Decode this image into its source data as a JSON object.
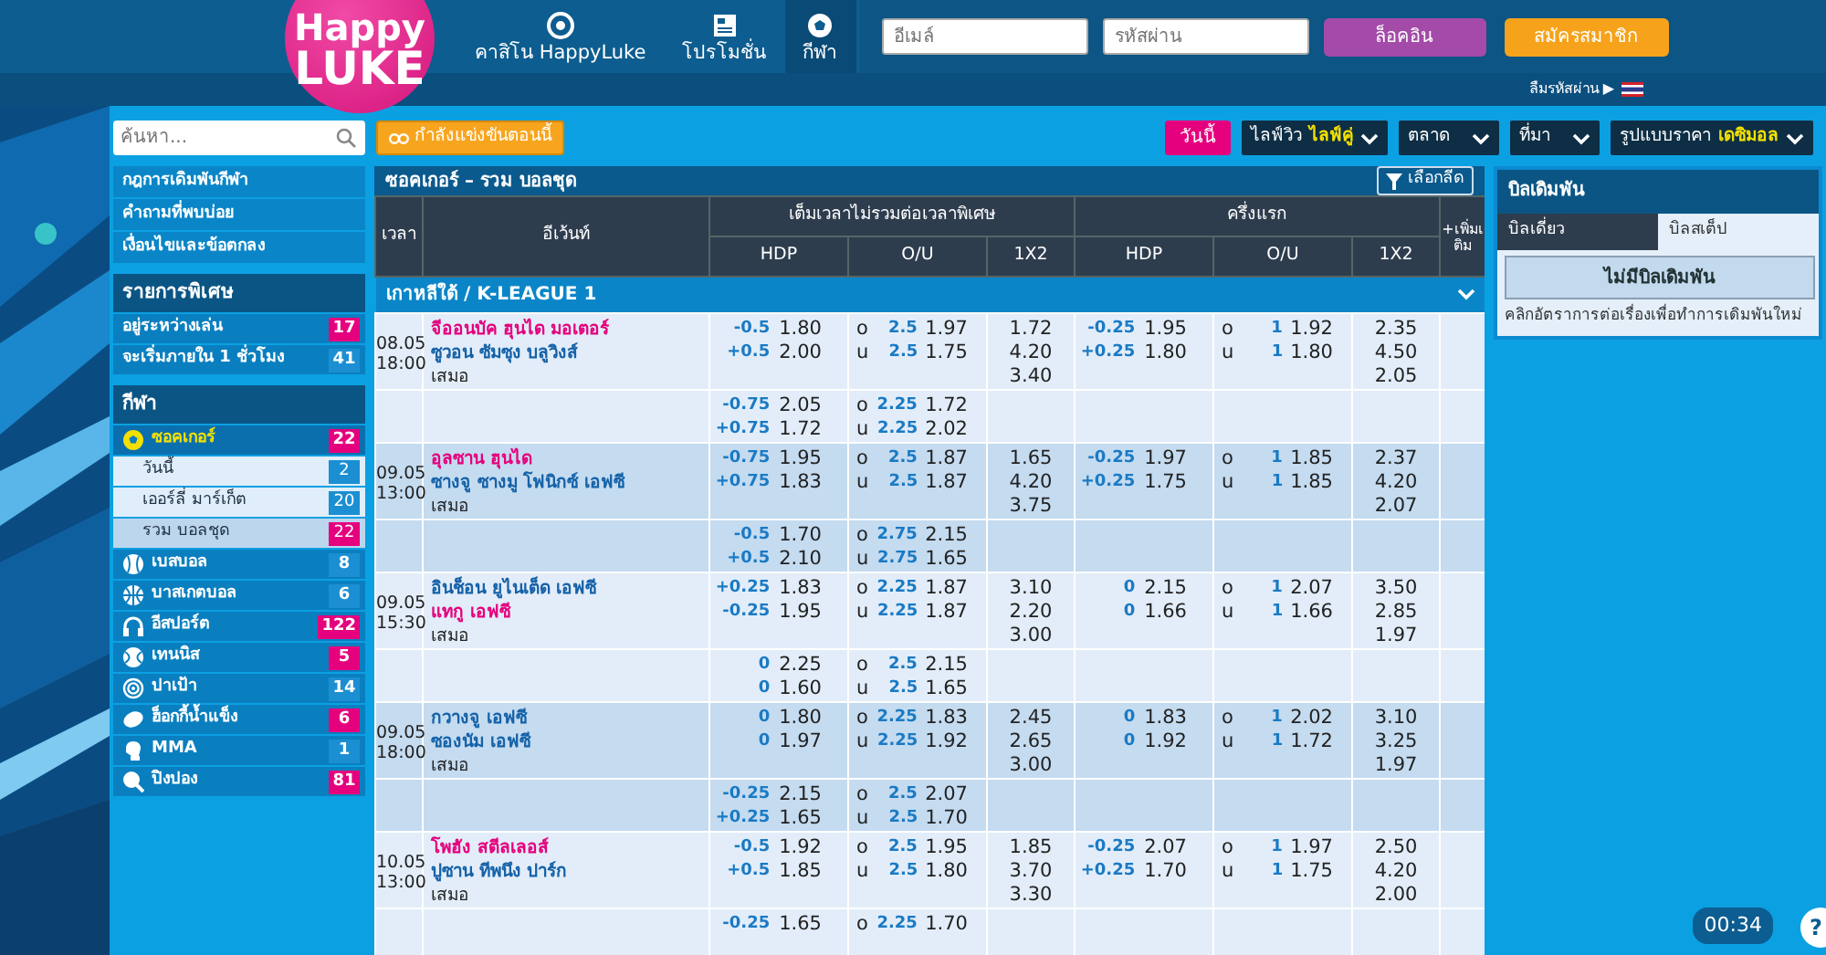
{
  "logo": {
    "line1": "Happy",
    "line2": "LUKE"
  },
  "nav": [
    {
      "label": "คาสิโน HappyLuke",
      "selected": false
    },
    {
      "label": "โปรโมชั่น",
      "selected": false
    },
    {
      "label": "กีฬา",
      "selected": true
    }
  ],
  "login": {
    "email_placeholder": "อีเมล์",
    "password_placeholder": "รหัสผ่าน",
    "login_button": "ล็อคอิน",
    "register_button": "สมัครสมาชิก",
    "forgot_link": "ลืมรหัสผ่าน ▶"
  },
  "toolbar": {
    "search_placeholder": "ค้นหา...",
    "live_button": "กำลังแข่งขันตอนนี้",
    "today_button": "วันนี้",
    "dropdowns": [
      {
        "label": "ไลฟ์วิว",
        "value": "ไลฟ์คู่"
      },
      {
        "label": "ตลาด"
      },
      {
        "label": "ที่มา"
      },
      {
        "label": "รูปแบบราคา",
        "value": "เดซิมอล"
      }
    ]
  },
  "sidebar": {
    "links": [
      "กฎการเดิมพันกีฬา",
      "คำถามที่พบบ่อย",
      "เงื่อนไขและข้อตกลง"
    ],
    "special_title": "รายการพิเศษ",
    "special": [
      {
        "name": "อยู่ระหว่างเล่น",
        "count": "17",
        "color": "#e5007d"
      },
      {
        "name": "จะเริ่มภายใน 1 ชั่วโมง",
        "count": "41",
        "color": "#1b8fd2"
      }
    ],
    "sports_title": "กีฬา",
    "sports": [
      {
        "name": "ซอคเกอร์",
        "count": "22",
        "color": "#e5007d",
        "selected": true,
        "expanded": true,
        "children": [
          {
            "name": "วันนี้",
            "count": "2",
            "color": "#1b8fd2",
            "selected": false
          },
          {
            "name": "เออร์ลี่ มาร์เก็ต",
            "count": "20",
            "color": "#1b8fd2",
            "selected": false
          },
          {
            "name": "รวม บอลชุด",
            "count": "22",
            "color": "#e5007d",
            "selected": true
          }
        ]
      },
      {
        "name": "เบสบอล",
        "count": "8",
        "color": "#1b8fd2",
        "selected": false
      },
      {
        "name": "บาสเกตบอล",
        "count": "6",
        "color": "#1b8fd2",
        "selected": false
      },
      {
        "name": "อีสปอร์ต",
        "count": "122",
        "color": "#e5007d",
        "selected": false
      },
      {
        "name": "เทนนิส",
        "count": "5",
        "color": "#e5007d",
        "selected": false
      },
      {
        "name": "ปาเป้า",
        "count": "14",
        "color": "#1b8fd2",
        "selected": false
      },
      {
        "name": "ฮ็อกกี้น้ำแข็ง",
        "count": "6",
        "color": "#e5007d",
        "selected": false
      },
      {
        "name": "MMA",
        "count": "1",
        "color": "#1b8fd2",
        "selected": false
      },
      {
        "name": "ปิงปอง",
        "count": "81",
        "color": "#e5007d",
        "selected": false
      }
    ]
  },
  "table": {
    "title": "ซอคเกอร์ – รวม บอลชุด",
    "filter_button": "เลือกลีด",
    "col_time": "เวลา",
    "col_event": "อีเว้นท์",
    "group_ft": "เต็มเวลาไม่รวมต่อเวลาพิเศษ",
    "group_fh": "ครึ่งแรก",
    "ft_cols": [
      "HDP",
      "O/U",
      "1X2"
    ],
    "fh_cols": [
      "HDP",
      "O/U",
      "1X2"
    ],
    "col_more": "+เพิ่มเติม",
    "league": {
      "name": "เกาหลีใต้ / K-LEAGUE 1",
      "expanded": true
    },
    "matches": [
      {
        "date": "08.05",
        "time": "18:00",
        "home": {
          "name": "จีออนบัค ฮุนได มอเตอร์",
          "favorite": true
        },
        "away": {
          "name": "ซูวอน ซัมซุง บลูวิงส์",
          "favorite": false
        },
        "draw": "เสมอ",
        "ft": {
          "hdp": [
            {
              "line": "-0.5",
              "odds": "1.80"
            },
            {
              "line": "+0.5",
              "odds": "2.00"
            }
          ],
          "ou": [
            {
              "side": "o",
              "line": "2.5",
              "odds": "1.97"
            },
            {
              "side": "u",
              "line": "2.5",
              "odds": "1.75"
            }
          ],
          "x12": [
            "1.72",
            "4.20",
            "3.40"
          ]
        },
        "fh": {
          "hdp": [
            {
              "line": "-0.25",
              "odds": "1.95"
            },
            {
              "line": "+0.25",
              "odds": "1.80"
            }
          ],
          "ou": [
            {
              "side": "o",
              "line": "1",
              "odds": "1.92"
            },
            {
              "side": "u",
              "line": "1",
              "odds": "1.80"
            }
          ],
          "x12": [
            "2.35",
            "4.50",
            "2.05"
          ]
        },
        "alt": {
          "hdp": [
            {
              "line": "-0.75",
              "odds": "2.05"
            },
            {
              "line": "+0.75",
              "odds": "1.72"
            }
          ],
          "ou": [
            {
              "side": "o",
              "line": "2.25",
              "odds": "1.72"
            },
            {
              "side": "u",
              "line": "2.25",
              "odds": "2.02"
            }
          ]
        }
      },
      {
        "date": "09.05",
        "time": "13:00",
        "home": {
          "name": "อุลซาน ฮุนได",
          "favorite": true
        },
        "away": {
          "name": "ซางจู ซางมู โฟนิกซ์ เอฟซี",
          "favorite": false
        },
        "draw": "เสมอ",
        "ft": {
          "hdp": [
            {
              "line": "-0.75",
              "odds": "1.95"
            },
            {
              "line": "+0.75",
              "odds": "1.83"
            }
          ],
          "ou": [
            {
              "side": "o",
              "line": "2.5",
              "odds": "1.87"
            },
            {
              "side": "u",
              "line": "2.5",
              "odds": "1.87"
            }
          ],
          "x12": [
            "1.65",
            "4.20",
            "3.75"
          ]
        },
        "fh": {
          "hdp": [
            {
              "line": "-0.25",
              "odds": "1.97"
            },
            {
              "line": "+0.25",
              "odds": "1.75"
            }
          ],
          "ou": [
            {
              "side": "o",
              "line": "1",
              "odds": "1.85"
            },
            {
              "side": "u",
              "line": "1",
              "odds": "1.85"
            }
          ],
          "x12": [
            "2.37",
            "4.20",
            "2.07"
          ]
        },
        "alt": {
          "hdp": [
            {
              "line": "-0.5",
              "odds": "1.70"
            },
            {
              "line": "+0.5",
              "odds": "2.10"
            }
          ],
          "ou": [
            {
              "side": "o",
              "line": "2.75",
              "odds": "2.15"
            },
            {
              "side": "u",
              "line": "2.75",
              "odds": "1.65"
            }
          ]
        }
      },
      {
        "date": "09.05",
        "time": "15:30",
        "home": {
          "name": "อินช็อน ยูไนเต็ด เอฟซี",
          "favorite": false
        },
        "away": {
          "name": "แทกู เอฟซี",
          "favorite": true
        },
        "draw": "เสมอ",
        "ft": {
          "hdp": [
            {
              "line": "+0.25",
              "odds": "1.83"
            },
            {
              "line": "-0.25",
              "odds": "1.95"
            }
          ],
          "ou": [
            {
              "side": "o",
              "line": "2.25",
              "odds": "1.87"
            },
            {
              "side": "u",
              "line": "2.25",
              "odds": "1.87"
            }
          ],
          "x12": [
            "3.10",
            "2.20",
            "3.00"
          ]
        },
        "fh": {
          "hdp": [
            {
              "line": "0",
              "odds": "2.15"
            },
            {
              "line": "0",
              "odds": "1.66"
            }
          ],
          "ou": [
            {
              "side": "o",
              "line": "1",
              "odds": "2.07"
            },
            {
              "side": "u",
              "line": "1",
              "odds": "1.66"
            }
          ],
          "x12": [
            "3.50",
            "2.85",
            "1.97"
          ]
        },
        "alt": {
          "hdp": [
            {
              "line": "0",
              "odds": "2.25"
            },
            {
              "line": "0",
              "odds": "1.60"
            }
          ],
          "ou": [
            {
              "side": "o",
              "line": "2.5",
              "odds": "2.15"
            },
            {
              "side": "u",
              "line": "2.5",
              "odds": "1.65"
            }
          ]
        }
      },
      {
        "date": "09.05",
        "time": "18:00",
        "home": {
          "name": "กวางจู เอฟซี",
          "favorite": false
        },
        "away": {
          "name": "ซองนัม เอฟซี",
          "favorite": false
        },
        "draw": "เสมอ",
        "ft": {
          "hdp": [
            {
              "line": "0",
              "odds": "1.80"
            },
            {
              "line": "0",
              "odds": "1.97"
            }
          ],
          "ou": [
            {
              "side": "o",
              "line": "2.25",
              "odds": "1.83"
            },
            {
              "side": "u",
              "line": "2.25",
              "odds": "1.92"
            }
          ],
          "x12": [
            "2.45",
            "2.65",
            "3.00"
          ]
        },
        "fh": {
          "hdp": [
            {
              "line": "0",
              "odds": "1.83"
            },
            {
              "line": "0",
              "odds": "1.92"
            }
          ],
          "ou": [
            {
              "side": "o",
              "line": "1",
              "odds": "2.02"
            },
            {
              "side": "u",
              "line": "1",
              "odds": "1.72"
            }
          ],
          "x12": [
            "3.10",
            "3.25",
            "1.97"
          ]
        },
        "alt": {
          "hdp": [
            {
              "line": "-0.25",
              "odds": "2.15"
            },
            {
              "line": "+0.25",
              "odds": "1.65"
            }
          ],
          "ou": [
            {
              "side": "o",
              "line": "2.5",
              "odds": "2.07"
            },
            {
              "side": "u",
              "line": "2.5",
              "odds": "1.70"
            }
          ]
        }
      },
      {
        "date": "10.05",
        "time": "13:00",
        "home": {
          "name": "โพฮัง สตีลเลอส์",
          "favorite": true
        },
        "away": {
          "name": "ปูซาน ทีพนึง ปาร์ก",
          "favorite": false
        },
        "draw": "เสมอ",
        "ft": {
          "hdp": [
            {
              "line": "-0.5",
              "odds": "1.92"
            },
            {
              "line": "+0.5",
              "odds": "1.85"
            }
          ],
          "ou": [
            {
              "side": "o",
              "line": "2.5",
              "odds": "1.95"
            },
            {
              "side": "u",
              "line": "2.5",
              "odds": "1.80"
            }
          ],
          "x12": [
            "1.85",
            "3.70",
            "3.30"
          ]
        },
        "fh": {
          "hdp": [
            {
              "line": "-0.25",
              "odds": "2.07"
            },
            {
              "line": "+0.25",
              "odds": "1.70"
            }
          ],
          "ou": [
            {
              "side": "o",
              "line": "1",
              "odds": "1.97"
            },
            {
              "side": "u",
              "line": "1",
              "odds": "1.75"
            }
          ],
          "x12": [
            "2.50",
            "4.20",
            "2.00"
          ]
        },
        "alt": {
          "hdp": [
            {
              "line": "-0.25",
              "odds": "1.65"
            }
          ],
          "ou": [
            {
              "side": "o",
              "line": "2.25",
              "odds": "1.70"
            }
          ]
        }
      }
    ]
  },
  "betslip": {
    "title": "บิลเดิมพัน",
    "tabs": [
      {
        "label": "บิลเดี่ยว",
        "selected": false
      },
      {
        "label": "บิลสเต็ป",
        "selected": true
      }
    ],
    "empty_button": "ไม่มีบิลเดิมพัน",
    "hint": "คลิกอัตราการต่อเรื่องเพื่อทำการเดิมพันใหม่"
  },
  "timer": "00:34",
  "help_button": "?"
}
